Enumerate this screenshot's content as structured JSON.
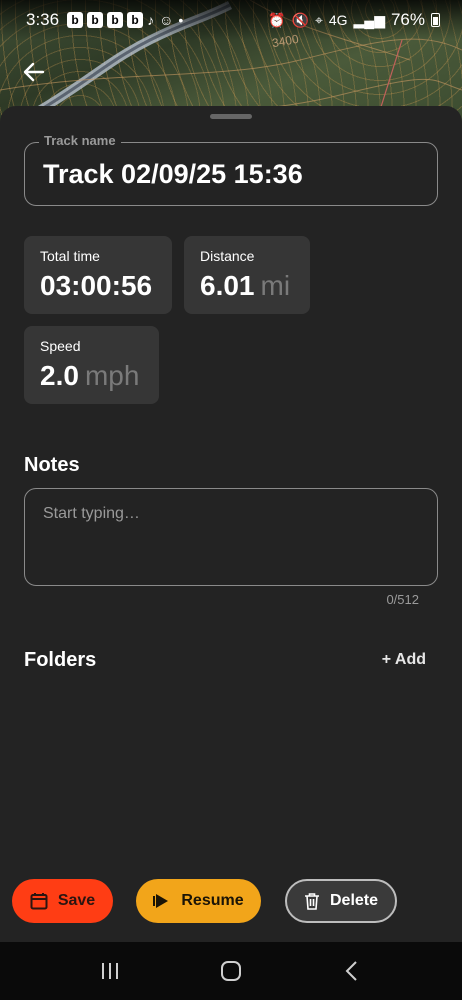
{
  "status_bar": {
    "time": "3:36",
    "app_badges": [
      "b",
      "b",
      "b",
      "b"
    ],
    "network": "4G",
    "battery": "76%"
  },
  "map": {
    "elevation_label": "3400"
  },
  "track": {
    "label": "Track name",
    "value": "Track 02/09/25 15:36"
  },
  "stats": {
    "total_time": {
      "label": "Total time",
      "value": "03:00:56"
    },
    "distance": {
      "label": "Distance",
      "value": "6.01",
      "unit": "mi"
    },
    "speed": {
      "label": "Speed",
      "value": "2.0",
      "unit": "mph"
    }
  },
  "notes": {
    "title": "Notes",
    "placeholder": "Start typing…",
    "counter": "0/512"
  },
  "folders": {
    "title": "Folders",
    "add_label": "+ Add"
  },
  "actions": {
    "save": "Save",
    "resume": "Resume",
    "delete": "Delete"
  },
  "colors": {
    "save": "#ff3d14",
    "resume": "#f2a51a",
    "sheet": "#232323"
  }
}
